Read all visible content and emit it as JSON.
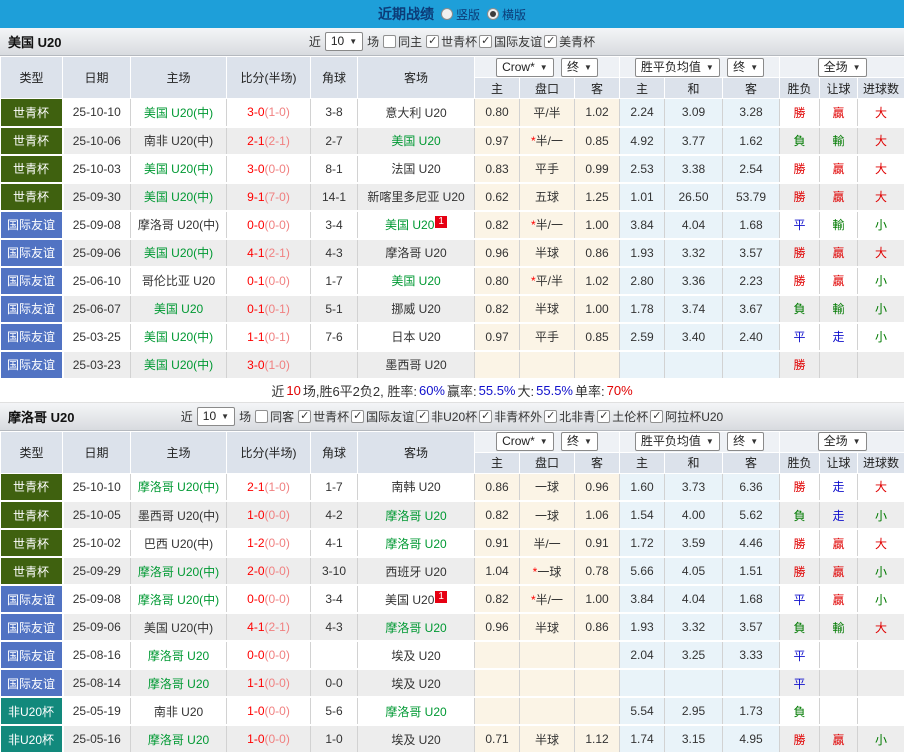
{
  "topbar": {
    "title": "近期战绩",
    "options": [
      {
        "label": "竖版",
        "selected": false
      },
      {
        "label": "横版",
        "selected": true
      }
    ]
  },
  "table_header": {
    "type": "类型",
    "date": "日期",
    "home": "主场",
    "score": "比分(半场)",
    "corner": "角球",
    "away": "客场",
    "odds_select": "Crow*",
    "final_select": "终",
    "avg_select": "胜平负均值",
    "scope_select": "全场",
    "odds_cols": [
      "主",
      "盘口",
      "客"
    ],
    "avg_cols": [
      "主",
      "和",
      "客"
    ],
    "result_cols": [
      "胜负",
      "让球",
      "进球数"
    ]
  },
  "type_colors": {
    "世青杯": "#3f610f",
    "国际友谊": "#5173c3",
    "非U20杯": "#12897c"
  },
  "sections": [
    {
      "team": "美国 U20",
      "filters": {
        "recent": "近",
        "count": "10",
        "games": "场",
        "same": {
          "label": "同主",
          "checked": false
        },
        "comps": [
          {
            "label": "世青杯",
            "checked": true
          },
          {
            "label": "国际友谊",
            "checked": true
          },
          {
            "label": "美青杯",
            "checked": true
          }
        ]
      },
      "rows": [
        {
          "type": "世青杯",
          "date": "25-10-10",
          "home": {
            "name": "美国 U20(中)",
            "green": true
          },
          "score": "3-0",
          "half": "(1-0)",
          "corner": "3-8",
          "away": {
            "name": "意大利 U20"
          },
          "odds": [
            "0.80",
            "平/半",
            "1.02"
          ],
          "avg": [
            "2.24",
            "3.09",
            "3.28"
          ],
          "res": [
            [
              "勝",
              "r"
            ],
            [
              "贏",
              "r"
            ],
            [
              "大",
              "r"
            ]
          ]
        },
        {
          "type": "世青杯",
          "date": "25-10-06",
          "home": {
            "name": "南非 U20(中)"
          },
          "score": "2-1",
          "half": "(2-1)",
          "corner": "2-7",
          "away": {
            "name": "美国 U20",
            "green": true
          },
          "odds": [
            "0.97",
            "*半/一",
            "0.85"
          ],
          "avg": [
            "4.92",
            "3.77",
            "1.62"
          ],
          "res": [
            [
              "負",
              "g"
            ],
            [
              "輸",
              "g"
            ],
            [
              "大",
              "r"
            ]
          ]
        },
        {
          "type": "世青杯",
          "date": "25-10-03",
          "home": {
            "name": "美国 U20(中)",
            "green": true
          },
          "score": "3-0",
          "half": "(0-0)",
          "corner": "8-1",
          "away": {
            "name": "法国 U20"
          },
          "odds": [
            "0.83",
            "平手",
            "0.99"
          ],
          "avg": [
            "2.53",
            "3.38",
            "2.54"
          ],
          "res": [
            [
              "勝",
              "r"
            ],
            [
              "贏",
              "r"
            ],
            [
              "大",
              "r"
            ]
          ]
        },
        {
          "type": "世青杯",
          "date": "25-09-30",
          "home": {
            "name": "美国 U20(中)",
            "green": true
          },
          "score": "9-1",
          "half": "(7-0)",
          "corner": "14-1",
          "away": {
            "name": "新喀里多尼亚 U20"
          },
          "odds": [
            "0.62",
            "五球",
            "1.25"
          ],
          "avg": [
            "1.01",
            "26.50",
            "53.79"
          ],
          "res": [
            [
              "勝",
              "r"
            ],
            [
              "贏",
              "r"
            ],
            [
              "大",
              "r"
            ]
          ]
        },
        {
          "type": "国际友谊",
          "date": "25-09-08",
          "home": {
            "name": "摩洛哥 U20(中)"
          },
          "score": "0-0",
          "half": "(0-0)",
          "corner": "3-4",
          "away": {
            "name": "美国 U20",
            "green": true,
            "badge": "1"
          },
          "odds": [
            "0.82",
            "*半/一",
            "1.00"
          ],
          "avg": [
            "3.84",
            "4.04",
            "1.68"
          ],
          "res": [
            [
              "平",
              "b"
            ],
            [
              "輸",
              "g"
            ],
            [
              "小",
              "g"
            ]
          ]
        },
        {
          "type": "国际友谊",
          "date": "25-09-06",
          "home": {
            "name": "美国 U20(中)",
            "green": true
          },
          "score": "4-1",
          "half": "(2-1)",
          "corner": "4-3",
          "away": {
            "name": "摩洛哥 U20"
          },
          "odds": [
            "0.96",
            "半球",
            "0.86"
          ],
          "avg": [
            "1.93",
            "3.32",
            "3.57"
          ],
          "res": [
            [
              "勝",
              "r"
            ],
            [
              "贏",
              "r"
            ],
            [
              "大",
              "r"
            ]
          ]
        },
        {
          "type": "国际友谊",
          "date": "25-06-10",
          "home": {
            "name": "哥伦比亚 U20"
          },
          "score": "0-1",
          "half": "(0-0)",
          "corner": "1-7",
          "away": {
            "name": "美国 U20",
            "green": true
          },
          "odds": [
            "0.80",
            "*平/半",
            "1.02"
          ],
          "avg": [
            "2.80",
            "3.36",
            "2.23"
          ],
          "res": [
            [
              "勝",
              "r"
            ],
            [
              "贏",
              "r"
            ],
            [
              "小",
              "g"
            ]
          ]
        },
        {
          "type": "国际友谊",
          "date": "25-06-07",
          "home": {
            "name": "美国 U20",
            "green": true
          },
          "score": "0-1",
          "half": "(0-1)",
          "corner": "5-1",
          "away": {
            "name": "挪威 U20"
          },
          "odds": [
            "0.82",
            "半球",
            "1.00"
          ],
          "avg": [
            "1.78",
            "3.74",
            "3.67"
          ],
          "res": [
            [
              "負",
              "g"
            ],
            [
              "輸",
              "g"
            ],
            [
              "小",
              "g"
            ]
          ]
        },
        {
          "type": "国际友谊",
          "date": "25-03-25",
          "home": {
            "name": "美国 U20(中)",
            "green": true
          },
          "score": "1-1",
          "half": "(0-1)",
          "corner": "7-6",
          "away": {
            "name": "日本 U20"
          },
          "odds": [
            "0.97",
            "平手",
            "0.85"
          ],
          "avg": [
            "2.59",
            "3.40",
            "2.40"
          ],
          "res": [
            [
              "平",
              "b"
            ],
            [
              "走",
              "b"
            ],
            [
              "小",
              "g"
            ]
          ]
        },
        {
          "type": "国际友谊",
          "date": "25-03-23",
          "home": {
            "name": "美国 U20(中)",
            "green": true
          },
          "score": "3-0",
          "half": "(1-0)",
          "corner": "",
          "away": {
            "name": "墨西哥 U20"
          },
          "odds": [
            "",
            "",
            ""
          ],
          "avg": [
            "",
            "",
            ""
          ],
          "res": [
            [
              "勝",
              "r"
            ],
            [
              "",
              ""
            ],
            [
              "",
              ""
            ]
          ]
        }
      ],
      "summary": [
        {
          "text": "近",
          "c": "k"
        },
        {
          "text": "10",
          "c": "r"
        },
        {
          "text": "场,胜6平2负2, 胜率:",
          "c": "k"
        },
        {
          "text": "60%",
          "c": "b"
        },
        {
          "text": " 赢率:",
          "c": "k"
        },
        {
          "text": "55.5%",
          "c": "b"
        },
        {
          "text": " 大:",
          "c": "k"
        },
        {
          "text": "55.5%",
          "c": "b"
        },
        {
          "text": " 单率:",
          "c": "k"
        },
        {
          "text": "70%",
          "c": "r"
        }
      ]
    },
    {
      "team": "摩洛哥 U20",
      "filters": {
        "recent": "近",
        "count": "10",
        "games": "场",
        "same": {
          "label": "同客",
          "checked": false
        },
        "comps": [
          {
            "label": "世青杯",
            "checked": true
          },
          {
            "label": "国际友谊",
            "checked": true
          },
          {
            "label": "非U20杯",
            "checked": true
          },
          {
            "label": "非青杯外",
            "checked": true
          },
          {
            "label": "北非青",
            "checked": true
          },
          {
            "label": "土伦杯",
            "checked": true
          },
          {
            "label": "阿拉杯U20",
            "checked": true
          }
        ]
      },
      "rows": [
        {
          "type": "世青杯",
          "date": "25-10-10",
          "home": {
            "name": "摩洛哥 U20(中)",
            "green": true
          },
          "score": "2-1",
          "half": "(1-0)",
          "corner": "1-7",
          "away": {
            "name": "南韩 U20"
          },
          "odds": [
            "0.86",
            "一球",
            "0.96"
          ],
          "avg": [
            "1.60",
            "3.73",
            "6.36"
          ],
          "res": [
            [
              "勝",
              "r"
            ],
            [
              "走",
              "b"
            ],
            [
              "大",
              "r"
            ]
          ]
        },
        {
          "type": "世青杯",
          "date": "25-10-05",
          "home": {
            "name": "墨西哥 U20(中)"
          },
          "score": "1-0",
          "half": "(0-0)",
          "corner": "4-2",
          "away": {
            "name": "摩洛哥 U20",
            "green": true
          },
          "odds": [
            "0.82",
            "一球",
            "1.06"
          ],
          "avg": [
            "1.54",
            "4.00",
            "5.62"
          ],
          "res": [
            [
              "負",
              "g"
            ],
            [
              "走",
              "b"
            ],
            [
              "小",
              "g"
            ]
          ]
        },
        {
          "type": "世青杯",
          "date": "25-10-02",
          "home": {
            "name": "巴西 U20(中)"
          },
          "score": "1-2",
          "half": "(0-0)",
          "corner": "4-1",
          "away": {
            "name": "摩洛哥 U20",
            "green": true
          },
          "odds": [
            "0.91",
            "半/一",
            "0.91"
          ],
          "avg": [
            "1.72",
            "3.59",
            "4.46"
          ],
          "res": [
            [
              "勝",
              "r"
            ],
            [
              "贏",
              "r"
            ],
            [
              "大",
              "r"
            ]
          ]
        },
        {
          "type": "世青杯",
          "date": "25-09-29",
          "home": {
            "name": "摩洛哥 U20(中)",
            "green": true
          },
          "score": "2-0",
          "half": "(0-0)",
          "corner": "3-10",
          "away": {
            "name": "西班牙 U20"
          },
          "odds": [
            "1.04",
            "*一球",
            "0.78"
          ],
          "avg": [
            "5.66",
            "4.05",
            "1.51"
          ],
          "res": [
            [
              "勝",
              "r"
            ],
            [
              "贏",
              "r"
            ],
            [
              "小",
              "g"
            ]
          ]
        },
        {
          "type": "国际友谊",
          "date": "25-09-08",
          "home": {
            "name": "摩洛哥 U20(中)",
            "green": true
          },
          "score": "0-0",
          "half": "(0-0)",
          "corner": "3-4",
          "away": {
            "name": "美国 U20",
            "badge": "1"
          },
          "odds": [
            "0.82",
            "*半/一",
            "1.00"
          ],
          "avg": [
            "3.84",
            "4.04",
            "1.68"
          ],
          "res": [
            [
              "平",
              "b"
            ],
            [
              "贏",
              "r"
            ],
            [
              "小",
              "g"
            ]
          ]
        },
        {
          "type": "国际友谊",
          "date": "25-09-06",
          "home": {
            "name": "美国 U20(中)"
          },
          "score": "4-1",
          "half": "(2-1)",
          "corner": "4-3",
          "away": {
            "name": "摩洛哥 U20",
            "green": true
          },
          "odds": [
            "0.96",
            "半球",
            "0.86"
          ],
          "avg": [
            "1.93",
            "3.32",
            "3.57"
          ],
          "res": [
            [
              "負",
              "g"
            ],
            [
              "輸",
              "g"
            ],
            [
              "大",
              "r"
            ]
          ]
        },
        {
          "type": "国际友谊",
          "date": "25-08-16",
          "home": {
            "name": "摩洛哥 U20",
            "green": true
          },
          "score": "0-0",
          "half": "(0-0)",
          "corner": "",
          "away": {
            "name": "埃及 U20"
          },
          "odds": [
            "",
            "",
            ""
          ],
          "avg": [
            "2.04",
            "3.25",
            "3.33"
          ],
          "res": [
            [
              "平",
              "b"
            ],
            [
              "",
              ""
            ],
            [
              "",
              ""
            ]
          ]
        },
        {
          "type": "国际友谊",
          "date": "25-08-14",
          "home": {
            "name": "摩洛哥 U20",
            "green": true
          },
          "score": "1-1",
          "half": "(0-0)",
          "corner": "0-0",
          "away": {
            "name": "埃及 U20"
          },
          "odds": [
            "",
            "",
            ""
          ],
          "avg": [
            "",
            "",
            ""
          ],
          "res": [
            [
              "平",
              "b"
            ],
            [
              "",
              ""
            ],
            [
              "",
              ""
            ]
          ]
        },
        {
          "type": "非U20杯",
          "date": "25-05-19",
          "home": {
            "name": "南非 U20"
          },
          "score": "1-0",
          "half": "(0-0)",
          "corner": "5-6",
          "away": {
            "name": "摩洛哥 U20",
            "green": true
          },
          "odds": [
            "",
            "",
            ""
          ],
          "avg": [
            "5.54",
            "2.95",
            "1.73"
          ],
          "res": [
            [
              "負",
              "g"
            ],
            [
              "",
              ""
            ],
            [
              "",
              ""
            ]
          ]
        },
        {
          "type": "非U20杯",
          "date": "25-05-16",
          "home": {
            "name": "摩洛哥 U20",
            "green": true
          },
          "score": "1-0",
          "half": "(0-0)",
          "corner": "1-0",
          "away": {
            "name": "埃及 U20"
          },
          "odds": [
            "0.71",
            "半球",
            "1.12"
          ],
          "avg": [
            "1.74",
            "3.15",
            "4.95"
          ],
          "res": [
            [
              "勝",
              "r"
            ],
            [
              "贏",
              "r"
            ],
            [
              "小",
              "g"
            ]
          ]
        }
      ],
      "summary": []
    }
  ]
}
